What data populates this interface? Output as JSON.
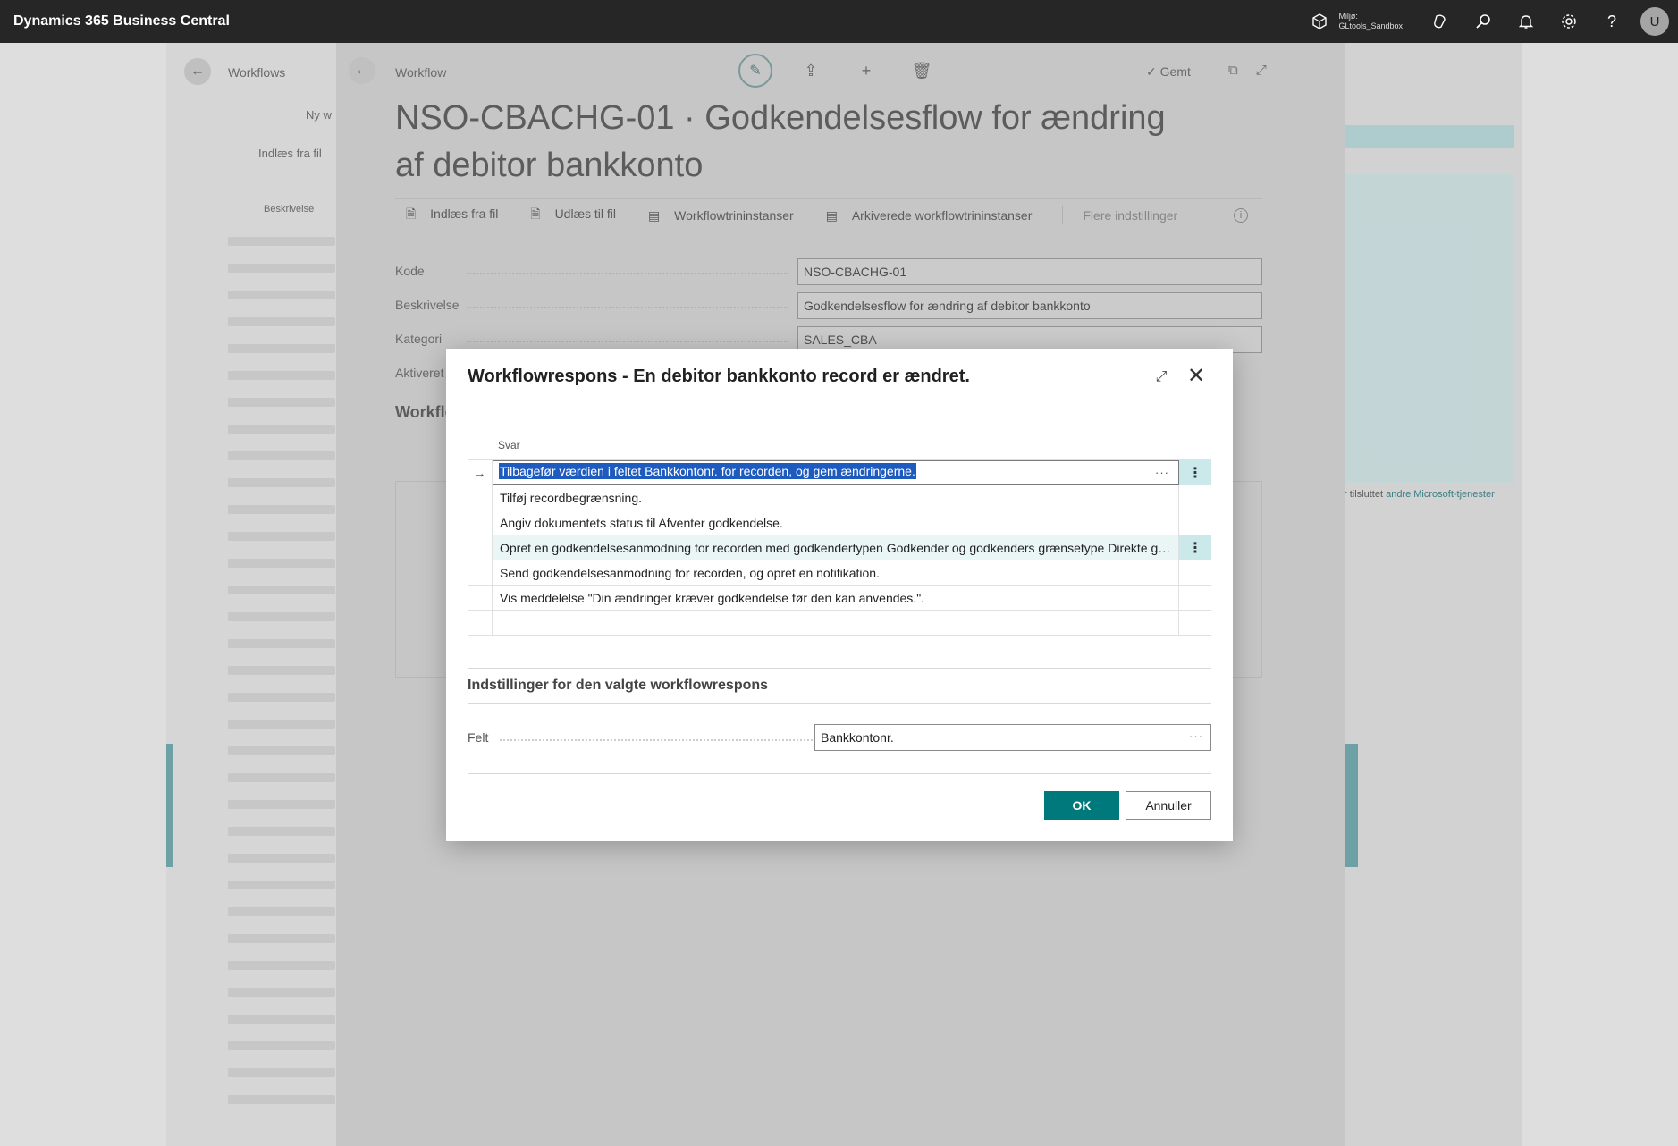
{
  "app": {
    "name": "Dynamics 365 Business Central",
    "environment_label": "Miljø:",
    "environment_name": "GLtools_Sandbox",
    "avatar_initial": "U"
  },
  "background": {
    "list_crumb": "Workflows",
    "list_new": "Ny w",
    "list_import": "Indlæs fra fil",
    "list_col": "Beskrivelse",
    "right_link_prefix": "r tilsluttet ",
    "right_link": "andre Microsoft-tjenester"
  },
  "workflow_card": {
    "crumb": "Workflow",
    "saved": "Gemt",
    "title": "NSO-CBACHG-01 · Godkendelsesflow for ændring af debitor bankkonto",
    "toolbar": [
      "Indlæs fra fil",
      "Udlæs til fil",
      "Workflowtrininstanser",
      "Arkiverede workflowtrininstanser",
      "Flere indstillinger"
    ],
    "fields": [
      {
        "label": "Kode",
        "value": "NSO-CBACHG-01"
      },
      {
        "label": "Beskrivelse",
        "value": "Godkendelsesflow for ændring af debitor bankkonto"
      },
      {
        "label": "Kategori",
        "value": "SALES_CBA"
      },
      {
        "label": "Aktiveret",
        "value": ""
      }
    ],
    "section_title": "Workflo"
  },
  "dialog": {
    "title": "Workflowrespons - En debitor bankkonto record er ændret.",
    "column_header": "Svar",
    "rows": [
      "Tilbagefør værdien i feltet Bankkontonr. for recorden, og gem ændringerne.",
      "Tilføj recordbegrænsning.",
      "Angiv dokumentets status til Afventer godkendelse.",
      "Opret en godkendelsesanmodning for recorden med godkendertypen Godkender og godkenders grænsetype Direkte godkender.",
      "Send godkendelsesanmodning for recorden, og opret en notifikation.",
      "Vis meddelelse \"Din ændringer kræver godkendelse før den kan anvendes.\".",
      ""
    ],
    "settings_title": "Indstillinger for den valgte workflowrespons",
    "field_label": "Felt",
    "field_value": "Bankkontonr.",
    "ok_label": "OK",
    "cancel_label": "Annuller"
  },
  "colors": {
    "topbar": "#262626",
    "accent": "#00797d",
    "selection": "#1e5bbf"
  }
}
